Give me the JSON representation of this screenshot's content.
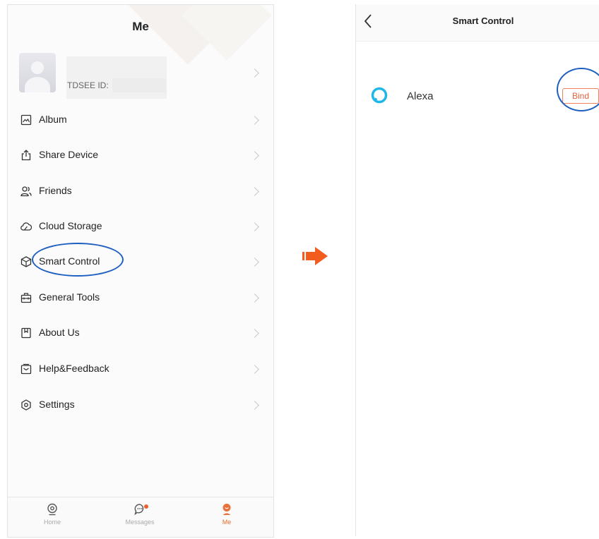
{
  "left_screen": {
    "title": "Me",
    "profile": {
      "id_label": "TDSEE ID:"
    },
    "menu": [
      {
        "label": "Album",
        "icon": "image-icon"
      },
      {
        "label": "Share Device",
        "icon": "share-icon"
      },
      {
        "label": "Friends",
        "icon": "friends-icon"
      },
      {
        "label": "Cloud Storage",
        "icon": "cloud-icon"
      },
      {
        "label": "Smart Control",
        "icon": "cube-icon"
      },
      {
        "label": "General Tools",
        "icon": "toolbox-icon"
      },
      {
        "label": "About Us",
        "icon": "bookmark-icon"
      },
      {
        "label": "Help&Feedback",
        "icon": "feedback-icon"
      },
      {
        "label": "Settings",
        "icon": "settings-icon"
      }
    ],
    "tabs": [
      {
        "label": "Home",
        "icon": "camera-icon",
        "active": false
      },
      {
        "label": "Messages",
        "icon": "chat-icon",
        "active": false,
        "badge": true
      },
      {
        "label": "Me",
        "icon": "user-icon",
        "active": true
      }
    ]
  },
  "right_screen": {
    "title": "Smart Control",
    "integrations": [
      {
        "name": "Alexa",
        "icon": "alexa-icon",
        "action": "Bind"
      }
    ]
  },
  "colors": {
    "accent": "#e8603a",
    "highlight": "#1f5fbf",
    "alexa": "#1fb6e8"
  }
}
